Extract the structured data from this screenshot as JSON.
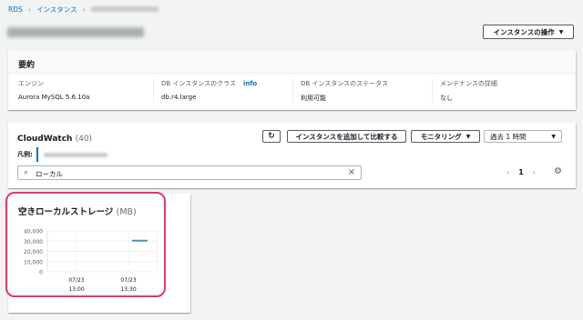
{
  "breadcrumb": {
    "root": "RDS",
    "instances": "インスタンス"
  },
  "actions_button": "インスタンスの操作",
  "summary": {
    "title": "要約",
    "columns": [
      {
        "key": "エンジン",
        "value": "Aurora MySQL 5.6.10a"
      },
      {
        "key": "DB インスタンスのクラス",
        "info": "info",
        "value": "db.r4.large"
      },
      {
        "key": "DB インスタンスのステータス",
        "value": "利用可能"
      },
      {
        "key": "メンテナンスの詳細",
        "value": "なし"
      }
    ]
  },
  "cloudwatch": {
    "title": "CloudWatch",
    "count": "(40)",
    "legend_label": "凡例:",
    "search_value": "ローカル",
    "add_compare_button": "インスタンスを追加して比較する",
    "monitoring_button": "モニタリング",
    "time_range": "過去 1 時間",
    "page": "1"
  },
  "chart_data": {
    "type": "line",
    "title": "空きローカルストレージ",
    "unit": "(MB)",
    "yticks": [
      "40,000",
      "30,000",
      "20,000",
      "10,000",
      "0"
    ],
    "ylim": [
      0,
      40000
    ],
    "xticks": [
      [
        "07/23",
        "13:00"
      ],
      [
        "07/23",
        "13:30"
      ]
    ],
    "series": [
      {
        "points": [
          [
            32,
            30500
          ],
          [
            41,
            30500
          ]
        ]
      }
    ],
    "line_color": "#4d91c4"
  },
  "colors": {
    "link": "#0073bb",
    "highlight": "#e8336e"
  }
}
